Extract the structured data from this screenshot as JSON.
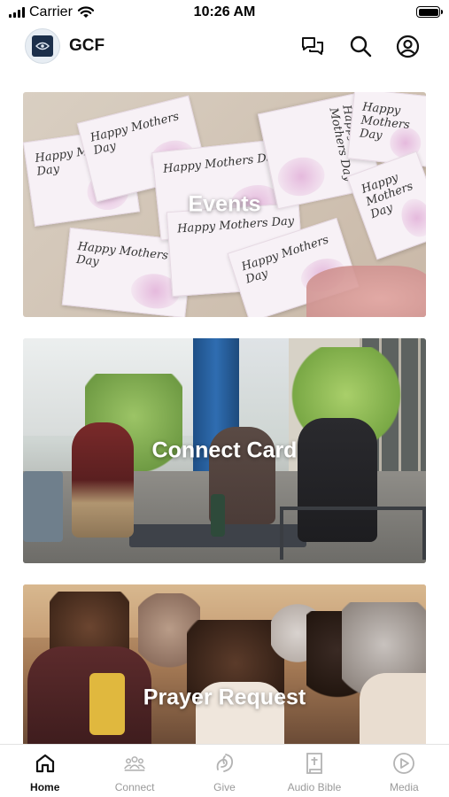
{
  "status_bar": {
    "carrier": "Carrier",
    "time": "10:26 AM"
  },
  "header": {
    "title": "GCF",
    "icons": [
      "chat-icon",
      "search-icon",
      "account-icon"
    ]
  },
  "cards": [
    {
      "label": "Events",
      "image_text": "Happy Mothers Day"
    },
    {
      "label": "Connect Card"
    },
    {
      "label": "Prayer Request"
    }
  ],
  "nav": {
    "items": [
      {
        "label": "Home",
        "icon": "home-icon",
        "active": true
      },
      {
        "label": "Connect",
        "icon": "people-icon",
        "active": false
      },
      {
        "label": "Give",
        "icon": "give-icon",
        "active": false
      },
      {
        "label": "Audio Bible",
        "icon": "bible-icon",
        "active": false
      },
      {
        "label": "Media",
        "icon": "play-icon",
        "active": false
      }
    ]
  },
  "colors": {
    "active": "#111111",
    "inactive": "#9a9a9a",
    "icon_inactive": "#b3b3b3"
  }
}
